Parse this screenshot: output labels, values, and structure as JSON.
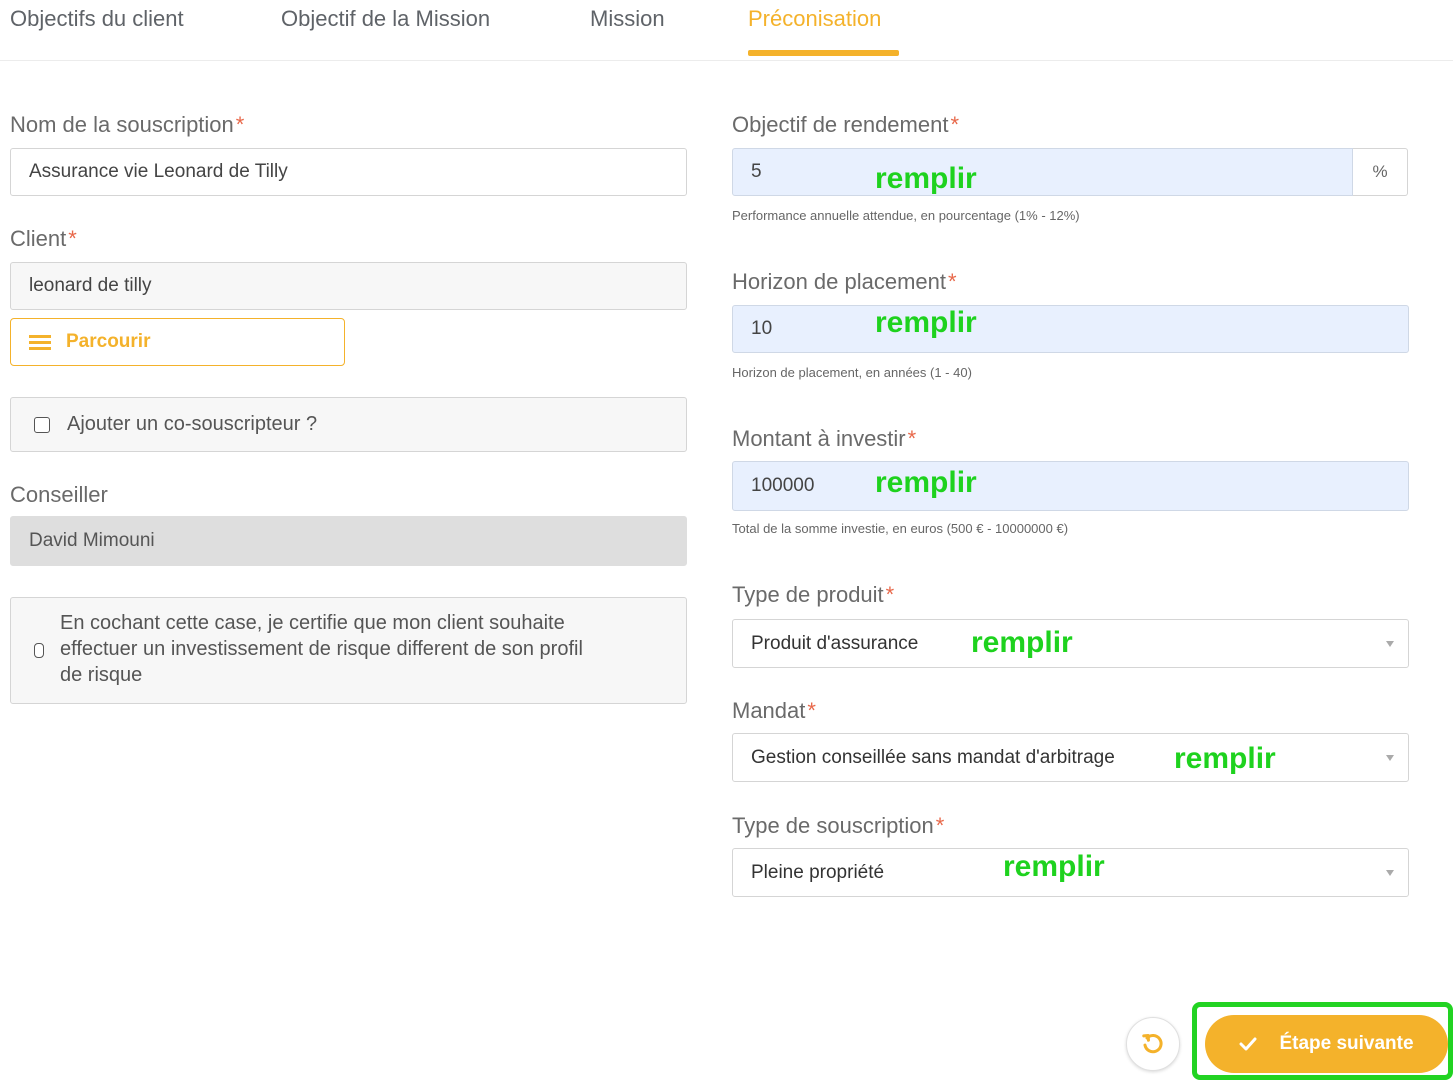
{
  "tabs": [
    {
      "label": "Objectifs du client"
    },
    {
      "label": "Objectif de la Mission"
    },
    {
      "label": "Mission"
    },
    {
      "label": "Préconisation"
    }
  ],
  "active_tab": "Préconisation",
  "left": {
    "subscription_name": {
      "label": "Nom de la souscription",
      "required": "*",
      "value": "Assurance vie Leonard de Tilly"
    },
    "client": {
      "label": "Client",
      "required": "*",
      "value": "leonard de tilly"
    },
    "browse_button": "Parcourir",
    "cosubscriber_checkbox": "Ajouter un co-souscripteur ?",
    "advisor": {
      "label": "Conseiller",
      "value": "David Mimouni"
    },
    "certify_lines": [
      "En cochant cette case, je certifie que mon client souhaite",
      "effectuer un investissement de risque different de son profil",
      "de risque"
    ]
  },
  "right": {
    "yield_target": {
      "label": "Objectif de rendement",
      "required": "*",
      "value": "5",
      "unit": "%",
      "hint": "Performance annuelle attendue, en pourcentage (1% - 12%)"
    },
    "horizon": {
      "label": "Horizon de placement",
      "required": "*",
      "value": "10",
      "hint": "Horizon de placement, en années (1 - 40)"
    },
    "amount": {
      "label": "Montant à investir",
      "required": "*",
      "value": "100000",
      "hint": "Total de la somme investie, en euros (500 € - 10000000 €)"
    },
    "product_type": {
      "label": "Type de produit",
      "required": "*",
      "value": "Produit d'assurance"
    },
    "mandate": {
      "label": "Mandat",
      "required": "*",
      "value": "Gestion conseillée sans mandat d'arbitrage"
    },
    "subscription_type": {
      "label": "Type de souscription",
      "required": "*",
      "value": "Pleine propriété"
    }
  },
  "annotation": "remplir",
  "footer": {
    "next_button": "Étape suivante"
  },
  "colors": {
    "accent": "#f4b22b",
    "annotation": "#1ed21e",
    "required": "#e8684a",
    "filled_input": "#e8f0fe"
  },
  "icons": [
    "list-icon",
    "checkbox-icon",
    "caret-down-icon",
    "reset-icon",
    "check-icon"
  ]
}
